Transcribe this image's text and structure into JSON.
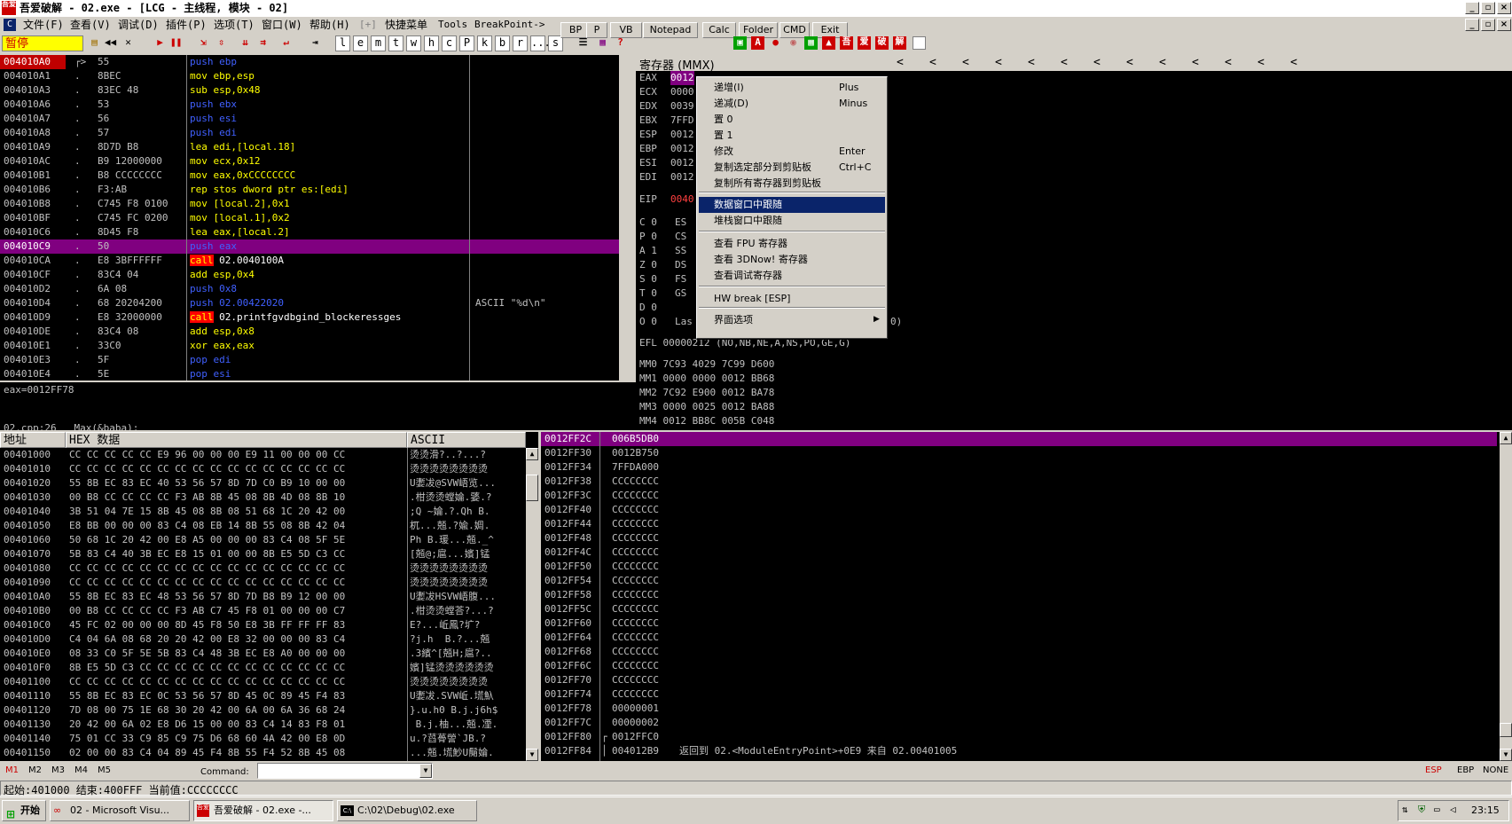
{
  "title": "吾爱破解 - 02.exe - [LCG -  主线程, 模块 - 02]",
  "menu": [
    "文件(F)",
    "查看(V)",
    "调试(D)",
    "插件(P)",
    "选项(T)",
    "窗口(W)",
    "帮助(H)",
    "[+]",
    "快捷菜单",
    "Tools",
    "BreakPoint->"
  ],
  "toolbar": {
    "pause": "暂停",
    "letters": [
      "l",
      "e",
      "m",
      "t",
      "w",
      "h",
      "c",
      "P",
      "k",
      "b",
      "r",
      "...",
      "s"
    ],
    "buttons": [
      "BP",
      "P",
      "VB",
      "Notepad",
      "Calc",
      "Folder",
      "CMD",
      "Exit"
    ]
  },
  "disasm": [
    [
      "004010A0",
      "┌>",
      "55",
      "push ebp",
      ""
    ],
    [
      "004010A1",
      ".",
      "8BEC",
      "mov ebp,esp",
      ""
    ],
    [
      "004010A3",
      ".",
      "83EC 48",
      "sub esp,0x48",
      ""
    ],
    [
      "004010A6",
      ".",
      "53",
      "push ebx",
      ""
    ],
    [
      "004010A7",
      ".",
      "56",
      "push esi",
      ""
    ],
    [
      "004010A8",
      ".",
      "57",
      "push edi",
      ""
    ],
    [
      "004010A9",
      ".",
      "8D7D B8",
      "lea edi,[local.18]",
      ""
    ],
    [
      "004010AC",
      ".",
      "B9 12000000",
      "mov ecx,0x12",
      ""
    ],
    [
      "004010B1",
      ".",
      "B8 CCCCCCCC",
      "mov eax,0xCCCCCCCC",
      ""
    ],
    [
      "004010B6",
      ".",
      "F3:AB",
      "rep stos dword ptr es:[edi]",
      ""
    ],
    [
      "004010B8",
      ".",
      "C745 F8 0100",
      "mov [local.2],0x1",
      ""
    ],
    [
      "004010BF",
      ".",
      "C745 FC 0200",
      "mov [local.1],0x2",
      ""
    ],
    [
      "004010C6",
      ".",
      "8D45 F8",
      "lea eax,[local.2]",
      ""
    ],
    [
      "004010C9",
      ".",
      "50",
      "push eax",
      ""
    ],
    [
      "004010CA",
      ".",
      "E8 3BFFFFFF",
      "call 02.0040100A",
      ""
    ],
    [
      "004010CF",
      ".",
      "83C4 04",
      "add esp,0x4",
      ""
    ],
    [
      "004010D2",
      ".",
      "6A 08",
      "push 0x8",
      ""
    ],
    [
      "004010D4",
      ".",
      "68 20204200",
      "push 02.00422020",
      "ASCII \"%d\\n\""
    ],
    [
      "004010D9",
      ".",
      "E8 32000000",
      "call 02.printfgvdbgind_blockeressges",
      ""
    ],
    [
      "004010DE",
      ".",
      "83C4 08",
      "add esp,0x8",
      ""
    ],
    [
      "004010E1",
      ".",
      "33C0",
      "xor eax,eax",
      ""
    ],
    [
      "004010E3",
      ".",
      "5F",
      "pop edi",
      ""
    ],
    [
      "004010E4",
      ".",
      "5E",
      "pop esi",
      ""
    ]
  ],
  "info": {
    "line1": "eax=0012FF78",
    "line2": "02.cpp:26   Max(&baba);"
  },
  "registers": {
    "title": "寄存器 (MMX)",
    "gp": [
      [
        "EAX",
        "0012"
      ],
      [
        "ECX",
        "0000"
      ],
      [
        "EDX",
        "0039"
      ],
      [
        "EBX",
        "7FFD"
      ],
      [
        "ESP",
        "0012"
      ],
      [
        "EBP",
        "0012"
      ],
      [
        "ESI",
        "0012"
      ],
      [
        "EDI",
        "0012"
      ]
    ],
    "eip": [
      "EIP",
      "0040"
    ],
    "flags": [
      [
        "C 0",
        "ES"
      ],
      [
        "P 0",
        "CS"
      ],
      [
        "A 1",
        "SS"
      ],
      [
        "Z 0",
        "DS"
      ],
      [
        "S 0",
        "FS"
      ],
      [
        "T 0",
        "GS"
      ],
      [
        "D 0",
        ""
      ],
      [
        "O 0",
        "Las"
      ]
    ],
    "flags_tail": "0)",
    "efl": "EFL 00000212 (NO,NB,NE,A,NS,PO,GE,G)",
    "mm": [
      "MM0 7C93 4029 7C99 D600",
      "MM1 0000 0000 0012 BB68",
      "MM2 7C92 E900 0012 BA78",
      "MM3 0000 0025 0012 BA88",
      "MM4 0012 BB8C 005B C048"
    ]
  },
  "context_menu": {
    "items": [
      {
        "label": "递增(I)",
        "shortcut": "Plus"
      },
      {
        "label": "递减(D)",
        "shortcut": "Minus"
      },
      {
        "label": "置 0",
        "shortcut": ""
      },
      {
        "label": "置 1",
        "shortcut": ""
      },
      {
        "label": "修改",
        "shortcut": "Enter"
      },
      {
        "label": "复制选定部分到剪贴板",
        "shortcut": "Ctrl+C"
      },
      {
        "label": "复制所有寄存器到剪贴板",
        "shortcut": ""
      },
      {
        "label": "数据窗口中跟随",
        "shortcut": ""
      },
      {
        "label": "堆栈窗口中跟随",
        "shortcut": ""
      },
      {
        "label": "查看 FPU 寄存器",
        "shortcut": ""
      },
      {
        "label": "查看 3DNow! 寄存器",
        "shortcut": ""
      },
      {
        "label": "查看调试寄存器",
        "shortcut": ""
      },
      {
        "label": "HW break [ESP]",
        "shortcut": ""
      },
      {
        "label": "界面选项",
        "shortcut": ""
      }
    ]
  },
  "dump": {
    "header_addr": "地址",
    "header_hex": "HEX 数据",
    "header_ascii": "ASCII",
    "rows": [
      [
        "00401000",
        "CC CC CC CC CC E9 96 00 00 00 E9 11 00 00 00 CC",
        "烫烫滑?..?...?"
      ],
      [
        "00401010",
        "CC CC CC CC CC CC CC CC CC CC CC CC CC CC CC CC",
        "烫烫烫烫烫烫烫烫"
      ],
      [
        "00401020",
        "55 8B EC 83 EC 40 53 56 57 8D 7D C0 B9 10 00 00",
        "U嬱冹@SVW峿览..."
      ],
      [
        "00401030",
        "00 B8 CC CC CC CC F3 AB 8B 45 08 8B 4D 08 8B 10",
        ".柑烫烫螳婨.婱.?"
      ],
      [
        "00401040",
        "3B 51 04 7E 15 8B 45 08 8B 08 51 68 1C 20 42 00",
        ";Q ~婨.?.Qh B."
      ],
      [
        "00401050",
        "E8 BB 00 00 00 83 C4 08 EB 14 8B 55 08 8B 42 04",
        "杌...兡.?婾.婤."
      ],
      [
        "00401060",
        "50 68 1C 20 42 00 E8 A5 00 00 00 83 C4 08 5F 5E",
        "Ph B.瑗...兡._^"
      ],
      [
        "00401070",
        "5B 83 C4 40 3B EC E8 15 01 00 00 8B E5 5D C3 CC",
        "[兡@;扈...嬪]锰"
      ],
      [
        "00401080",
        "CC CC CC CC CC CC CC CC CC CC CC CC CC CC CC CC",
        "烫烫烫烫烫烫烫烫"
      ],
      [
        "00401090",
        "CC CC CC CC CC CC CC CC CC CC CC CC CC CC CC CC",
        "烫烫烫烫烫烫烫烫"
      ],
      [
        "004010A0",
        "55 8B EC 83 EC 48 53 56 57 8D 7D B8 B9 12 00 00",
        "U嬱冹HSVW峿腹..."
      ],
      [
        "004010B0",
        "00 B8 CC CC CC CC F3 AB C7 45 F8 01 00 00 00 C7",
        ".柑烫烫螳荅?...?"
      ],
      [
        "004010C0",
        "45 FC 02 00 00 00 8D 45 F8 50 E8 3B FF FF FF 83",
        "E?...岴鳳?圹?"
      ],
      [
        "004010D0",
        "C4 04 6A 08 68 20 20 42 00 E8 32 00 00 00 83 C4",
        "?j.h  B.?...兡"
      ],
      [
        "004010E0",
        "08 33 C0 5F 5E 5B 83 C4 48 3B EC E8 A0 00 00 00",
        ".3繽^[兡H;扈?.."
      ],
      [
        "004010F0",
        "8B E5 5D C3 CC CC CC CC CC CC CC CC CC CC CC CC",
        "嬪]锰烫烫烫烫烫烫"
      ],
      [
        "00401100",
        "CC CC CC CC CC CC CC CC CC CC CC CC CC CC CC CC",
        "烫烫烫烫烫烫烫烫"
      ],
      [
        "00401110",
        "55 8B EC 83 EC 0C 53 56 57 8D 45 0C 89 45 F4 83",
        "U嬱冹.SVW岴.塃魞"
      ],
      [
        "00401120",
        "7D 08 00 75 1E 68 30 20 42 00 6A 00 6A 36 68 24",
        "}.u.h0 B.j.j6h$"
      ],
      [
        "00401130",
        "20 42 00 6A 02 E8 D6 15 00 00 83 C4 14 83 F8 01",
        " B.j.柚...兡.凐."
      ],
      [
        "00401140",
        "75 01 CC 33 C9 85 C9 75 D6 68 60 4A 42 00 E8 0D",
        "u.?蓞蓇謍`JB.?"
      ],
      [
        "00401150",
        "02 00 00 83 C4 04 89 45 F4 8B 55 F4 52 8B 45 08",
        "...兡.塃魦U鬜婨."
      ]
    ]
  },
  "stack": {
    "rows": [
      [
        "0012FF2C",
        "006B5DB0",
        ""
      ],
      [
        "0012FF30",
        "0012B750",
        ""
      ],
      [
        "0012FF34",
        "7FFDA000",
        ""
      ],
      [
        "0012FF38",
        "CCCCCCCC",
        ""
      ],
      [
        "0012FF3C",
        "CCCCCCCC",
        ""
      ],
      [
        "0012FF40",
        "CCCCCCCC",
        ""
      ],
      [
        "0012FF44",
        "CCCCCCCC",
        ""
      ],
      [
        "0012FF48",
        "CCCCCCCC",
        ""
      ],
      [
        "0012FF4C",
        "CCCCCCCC",
        ""
      ],
      [
        "0012FF50",
        "CCCCCCCC",
        ""
      ],
      [
        "0012FF54",
        "CCCCCCCC",
        ""
      ],
      [
        "0012FF58",
        "CCCCCCCC",
        ""
      ],
      [
        "0012FF5C",
        "CCCCCCCC",
        ""
      ],
      [
        "0012FF60",
        "CCCCCCCC",
        ""
      ],
      [
        "0012FF64",
        "CCCCCCCC",
        ""
      ],
      [
        "0012FF68",
        "CCCCCCCC",
        ""
      ],
      [
        "0012FF6C",
        "CCCCCCCC",
        ""
      ],
      [
        "0012FF70",
        "CCCCCCCC",
        ""
      ],
      [
        "0012FF74",
        "CCCCCCCC",
        ""
      ],
      [
        "0012FF78",
        "00000001",
        ""
      ],
      [
        "0012FF7C",
        "00000002",
        ""
      ],
      [
        "0012FF80",
        "0012FFC0",
        ""
      ],
      [
        "0012FF84",
        "004012B9",
        "返回到 02.<ModuleEntryPoint>+0E9 来自 02.00401005"
      ]
    ]
  },
  "command": {
    "tabs": [
      "M1",
      "M2",
      "M3",
      "M4",
      "M5"
    ],
    "label": "Command:",
    "value": "",
    "flags": [
      "ESP",
      "EBP",
      "NONE"
    ]
  },
  "status": "起始:401000 结束:400FFF 当前值:CCCCCCCC",
  "taskbar": {
    "start": "开始",
    "tasks": [
      "02 - Microsoft Visu...",
      "吾爱破解 - 02.exe -...",
      "C:\\02\\Debug\\02.exe"
    ],
    "clock": "23:15"
  }
}
